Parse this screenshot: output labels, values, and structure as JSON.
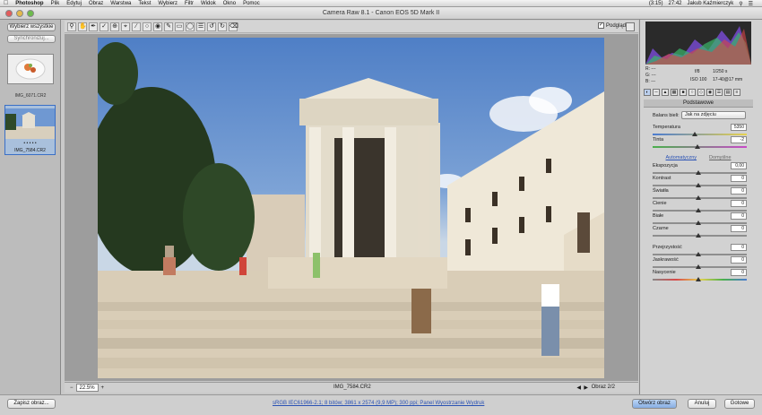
{
  "menubar": {
    "apple": "",
    "app": "Photoshop",
    "items": [
      "Plik",
      "Edytuj",
      "Obraz",
      "Warstwa",
      "Tekst",
      "Wybierz",
      "Filtr",
      "Widok",
      "Okno",
      "Pomoc"
    ],
    "right": {
      "battery": "(3:15)",
      "clock": "27:42",
      "user": "Jakub Kaźmierczyk"
    }
  },
  "window": {
    "title": "Camera Raw 8.1  -  Canon EOS 5D Mark II"
  },
  "toolbar": {
    "tools": [
      "zoom-icon",
      "hand-icon",
      "white-balance-icon",
      "color-sampler-icon",
      "target-adjust-icon",
      "crop-icon",
      "straighten-icon",
      "spot-removal-icon",
      "red-eye-icon",
      "adjustment-brush-icon",
      "graduated-filter-icon",
      "radial-filter-icon",
      "preferences-icon",
      "rotate-ccw-icon",
      "rotate-cw-icon",
      "trash-icon"
    ],
    "preview_label": "Podgląd",
    "preview_checked": "✓"
  },
  "filmstrip": {
    "select_all": "Wybierz wszystkie",
    "synchronize": "Synchronizuj...",
    "items": [
      {
        "label": "IMG_6071.CR2",
        "rating": ""
      },
      {
        "label": "IMG_7584.CR2",
        "rating": "• • • • •"
      }
    ]
  },
  "preview": {
    "zoom_minus": "−",
    "zoom_value": "22.5%",
    "zoom_plus": "+",
    "filename": "IMG_7584.CR2",
    "image_count": "Obraz 2/2"
  },
  "histogram_meta": {
    "r_label": "R:",
    "g_label": "G:",
    "b_label": "B:",
    "r": "---",
    "g": "---",
    "b": "---",
    "aperture": "f/8",
    "shutter": "1/250 s",
    "iso": "ISO 100",
    "focal": "17-40@17 mm"
  },
  "panel": {
    "section_title": "Podstawowe",
    "white_balance_label": "Balans bieli:",
    "white_balance_value": "Jak na zdjęciu",
    "temperature_label": "Temperatura",
    "temperature_value": "5350",
    "tint_label": "Tinta",
    "tint_value": "-2",
    "auto_link": "Automatyczny",
    "default_link": "Domyślne",
    "rows": [
      {
        "label": "Ekspozycja",
        "value": "0,00"
      },
      {
        "label": "Kontrast",
        "value": "0"
      },
      {
        "label": "Światła",
        "value": "0"
      },
      {
        "label": "Cienie",
        "value": "0"
      },
      {
        "label": "Białe",
        "value": "0"
      },
      {
        "label": "Czarne",
        "value": "0"
      },
      {
        "label": "Przejrzystość",
        "value": "0"
      },
      {
        "label": "Jaskrawość",
        "value": "0"
      },
      {
        "label": "Nasycenie",
        "value": "0"
      }
    ]
  },
  "footer": {
    "save": "Zapisz obraz...",
    "workflow": "sRGB IEC61966-2.1; 8 bitów; 3861 x 2574 (9,9 MP); 300 ppi; Panel Wyostrzanie Wydruk",
    "open": "Otwórz obraz",
    "cancel": "Anuluj",
    "done": "Gotowe"
  },
  "colors": {
    "accent": "#2a52b4",
    "open_button": "#9fc0ea"
  }
}
